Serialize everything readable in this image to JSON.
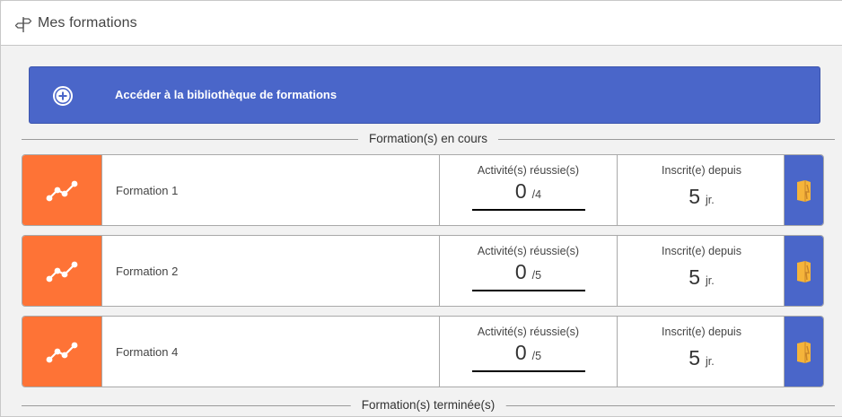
{
  "header": {
    "title": "Mes formations",
    "icon": "signpost-icon"
  },
  "library_button": {
    "label": "Accéder à la bibliothèque de formations",
    "icon": "plus-circle-icon"
  },
  "sections": {
    "in_progress": "Formation(s) en cours",
    "completed": "Formation(s) terminée(s)"
  },
  "courses": [
    {
      "name": "Formation 1",
      "activities_label": "Activité(s) réussie(s)",
      "activities_done": "0",
      "activities_total": "/4",
      "progress": 0,
      "since_label": "Inscrit(e) depuis",
      "since_value": "5",
      "since_unit": "jr."
    },
    {
      "name": "Formation 2",
      "activities_label": "Activité(s) réussie(s)",
      "activities_done": "0",
      "activities_total": "/5",
      "progress": 0,
      "since_label": "Inscrit(e) depuis",
      "since_value": "5",
      "since_unit": "jr."
    },
    {
      "name": "Formation 4",
      "activities_label": "Activité(s) réussie(s)",
      "activities_done": "0",
      "activities_total": "/5",
      "progress": 0,
      "since_label": "Inscrit(e) depuis",
      "since_value": "5",
      "since_unit": "jr."
    }
  ],
  "colors": {
    "accent_blue": "#4a66c9",
    "course_orange": "#fe7336",
    "door_yellow": "#f5b43a",
    "background": "#f2f2f2"
  }
}
